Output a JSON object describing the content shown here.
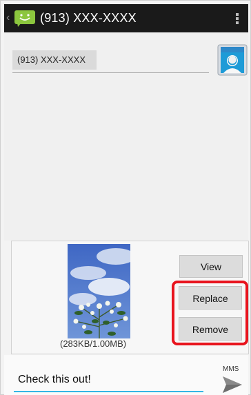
{
  "header": {
    "title": "(913) XXX-XXXX",
    "back_icon": "chevron-left-icon",
    "app_icon": "messaging-app-icon",
    "menu_icon": "overflow-menu-icon"
  },
  "recipient": {
    "chip_text": "(913) XXX-XXXX",
    "contact_icon": "contact-card-icon"
  },
  "attachment": {
    "size_text": "(283KB/1.00MB)",
    "view_label": "View",
    "replace_label": "Replace",
    "remove_label": "Remove"
  },
  "compose": {
    "message_text": "Check this out!",
    "type_label": "MMS",
    "send_icon": "send-icon"
  },
  "colors": {
    "action_bar": "#1a1a1a",
    "accent": "#33b5e5",
    "highlight": "#e8141e",
    "app_icon_green": "#8cc63e"
  }
}
